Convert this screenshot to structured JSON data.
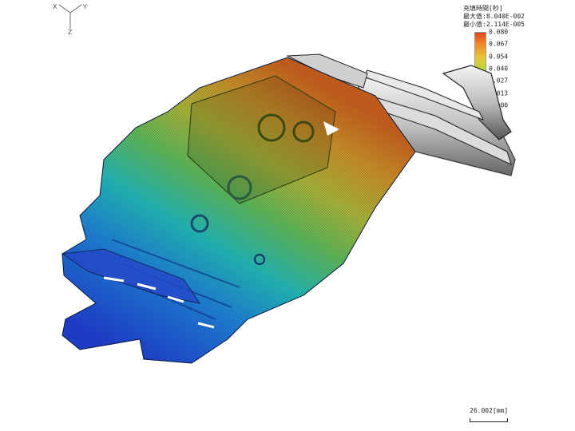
{
  "axes": {
    "x": "X",
    "y": "Y",
    "z": "Z"
  },
  "legend": {
    "title": "充填時間[秒]",
    "max": "最大值:8.040E-002",
    "min": "最小值:2.114E-005",
    "ticks": [
      "0.080",
      "0.067",
      "0.054",
      "0.040",
      "0.027",
      "0.013",
      "0.000"
    ],
    "gradient_colors": [
      "#e0481c",
      "#f08a2a",
      "#e8c23a",
      "#b9d83a",
      "#4fd06a",
      "#22c7c7",
      "#1c86e6",
      "#1c2fd6"
    ]
  },
  "scale": {
    "label": "26.002[mm]"
  }
}
